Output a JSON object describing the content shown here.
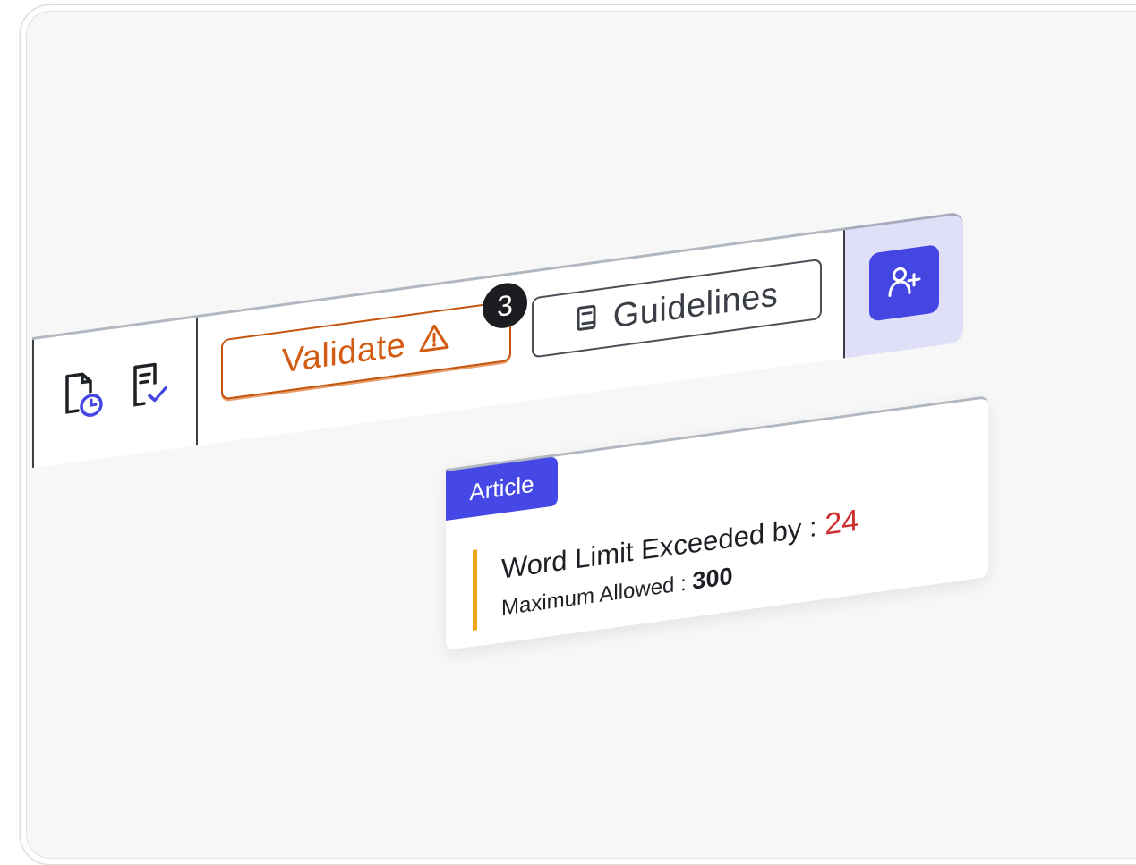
{
  "toolbar": {
    "icons": [
      "file-clock-icon",
      "file-check-icon"
    ],
    "validate_label": "Validate",
    "validate_icon": "warning-triangle-icon",
    "issue_count": "3",
    "guidelines_label": "Guidelines",
    "guidelines_icon": "book-icon",
    "add_user_icon": "user-plus-icon"
  },
  "validation_card": {
    "section_tag": "Article",
    "message_label": "Word Limit Exceeded by",
    "separator": ":",
    "exceeded_by": "24",
    "max_label": "Maximum Allowed",
    "max_value": "300"
  },
  "colors": {
    "accent": "#4346e0",
    "warning": "#d35a11",
    "error": "#cf2f2f",
    "highlight": "#f0a418"
  }
}
